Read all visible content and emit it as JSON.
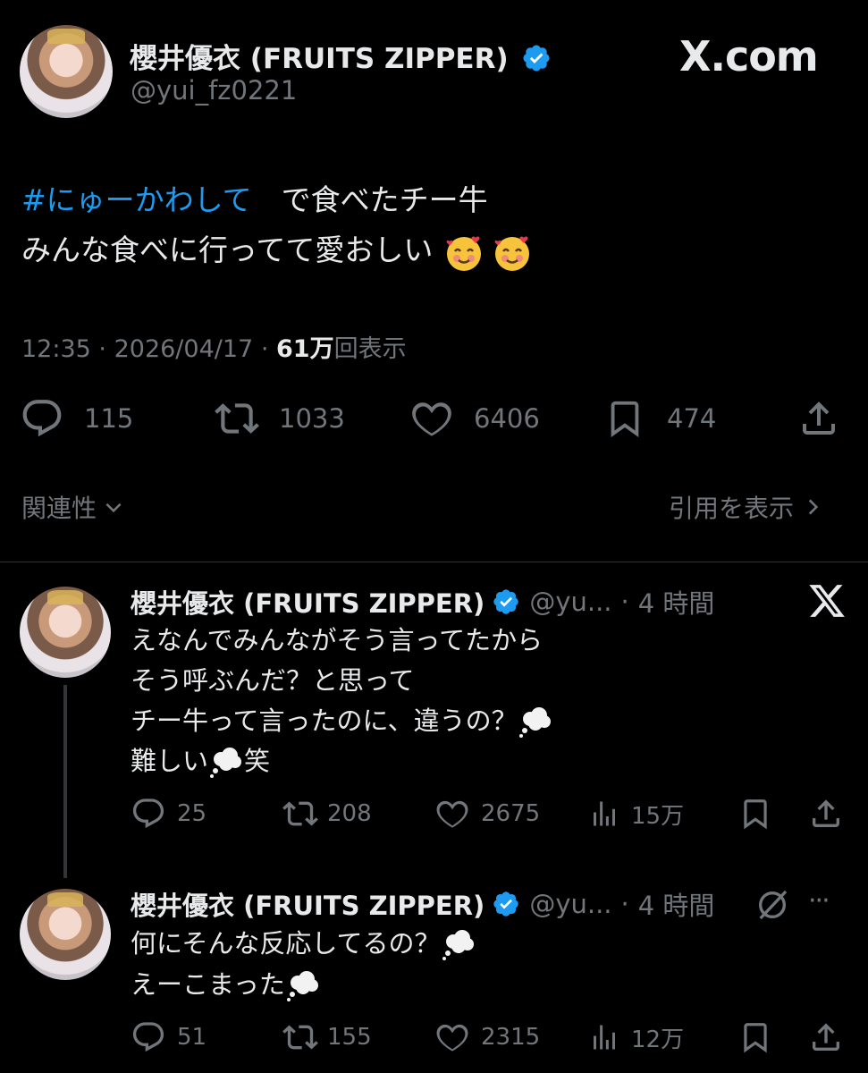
{
  "main_tweet": {
    "display_name": "櫻井優衣 (FRUITS ZIPPER)",
    "handle": "@yui_fz0221",
    "site_logo": "X.com",
    "hashtag": "#にゅーかわして",
    "line1_rest": "　で食べたチー牛",
    "line2": "みんな食べに行ってて愛おしい",
    "line2_emojis": [
      "smiling-face-with-hearts",
      "smiling-face-with-hearts"
    ],
    "time": "12:35",
    "sep": "·",
    "date": "2026/04/17",
    "views_count": "61万",
    "views_label": "回表示",
    "replies": "115",
    "reposts": "1033",
    "likes": "6406",
    "bookmarks": "474",
    "sort_label": "関連性",
    "quotes_link": "引用を表示"
  },
  "replies": [
    {
      "display_name": "櫻井優衣 (FRUITS ZIPPER)",
      "handle": "@yu...",
      "sep": "·",
      "time": "4 時間",
      "lines": [
        "えなんでみんながそう言ってたから",
        "そう呼ぶんだ？と思って",
        "チー牛って言ったのに、違うの？",
        "難しい",
        "笑"
      ],
      "replies": "25",
      "reposts": "208",
      "likes": "2675",
      "views": "15万"
    },
    {
      "display_name": "櫻井優衣 (FRUITS ZIPPER)",
      "handle": "@yu...",
      "sep": "·",
      "time": "4 時間",
      "more": "···",
      "lines": [
        "何にそんな反応してるの？",
        "えーこまった"
      ],
      "replies": "51",
      "reposts": "155",
      "likes": "2315",
      "views": "12万"
    }
  ],
  "colors": {
    "background": "#000000",
    "text": "#e7e9ea",
    "muted": "#71767b",
    "link": "#1d9bf0",
    "verified": "#1d9bf0"
  }
}
